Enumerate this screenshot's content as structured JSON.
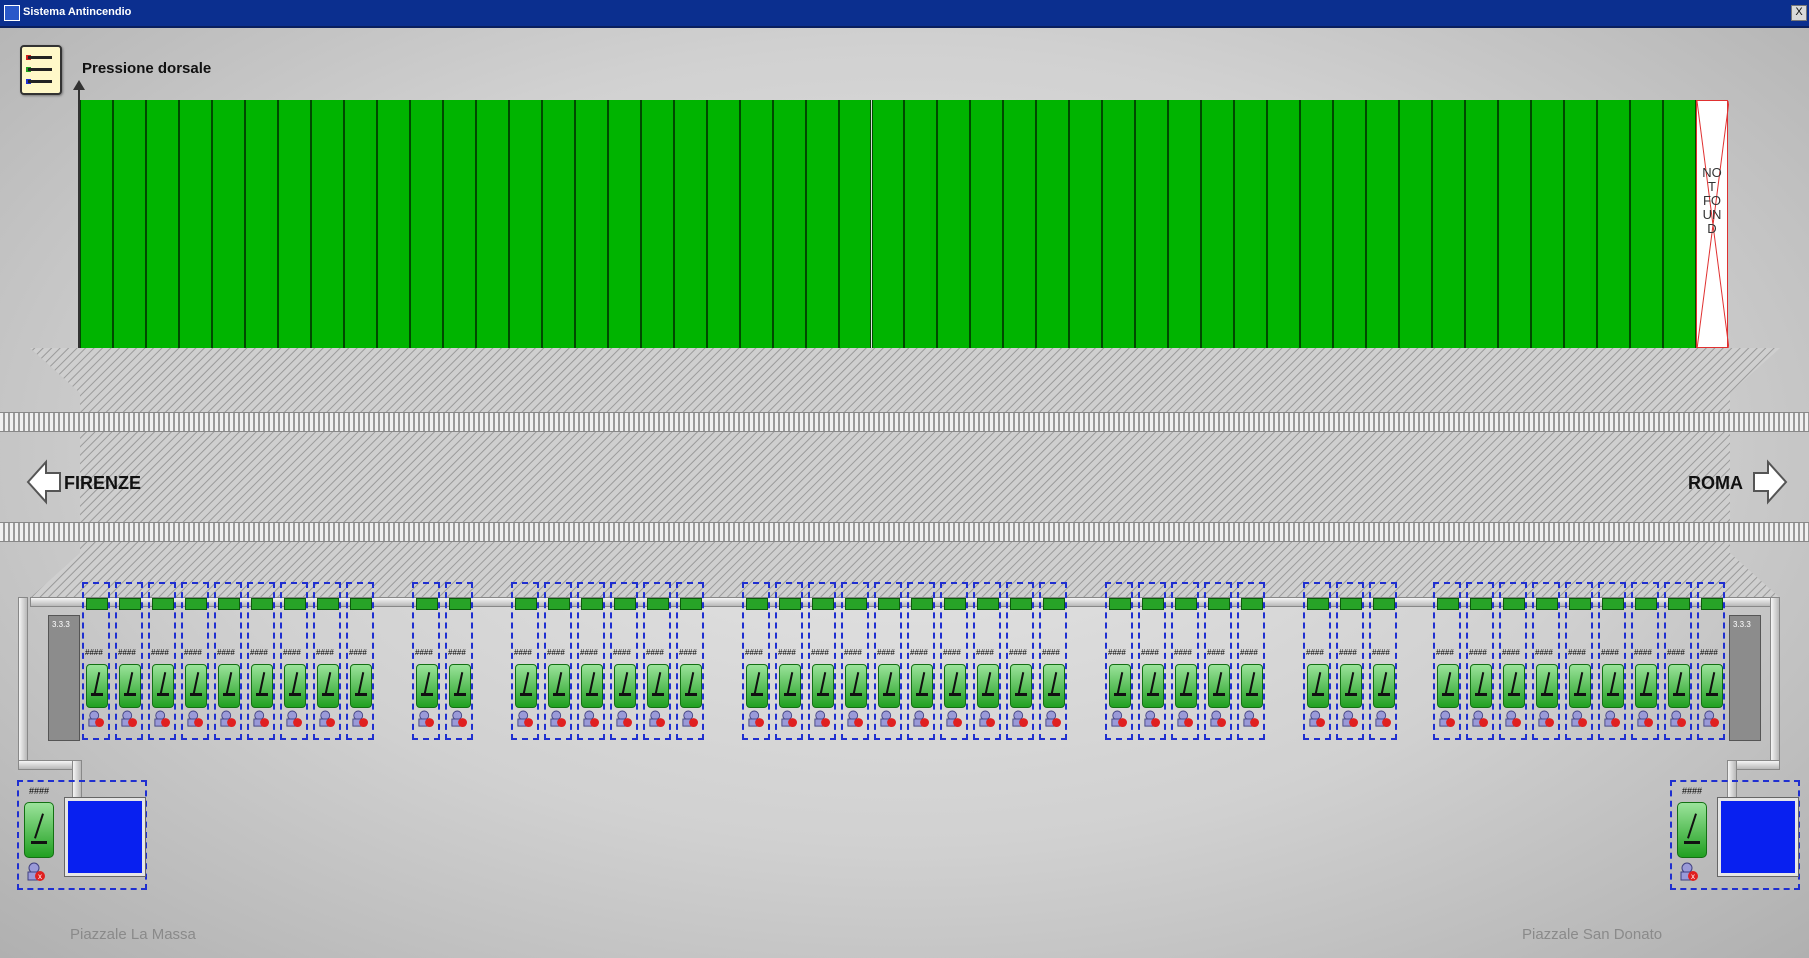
{
  "window": {
    "title": "Sistema Antincendio",
    "close_label": "X"
  },
  "pressure": {
    "title": "Pressione dorsale",
    "bar_count": 49,
    "bar_color": "#00b400",
    "not_found_label": "NO\nT\nFO\nUN\nD"
  },
  "directions": {
    "left": "FIRENZE",
    "right": "ROMA"
  },
  "stations": {
    "groups": [
      9,
      2,
      6,
      10,
      5,
      3,
      9
    ],
    "hash_label": "####",
    "side_label": "3.3.3"
  },
  "tanks": {
    "hash_label": "####"
  },
  "squares": {
    "left": "Piazzale La Massa",
    "right": "Piazzale San Donato"
  },
  "colors": {
    "accent": "#1f2fd0",
    "bar": "#00b400",
    "tank": "#0820f0",
    "titlebar": "#0b2f8f"
  }
}
